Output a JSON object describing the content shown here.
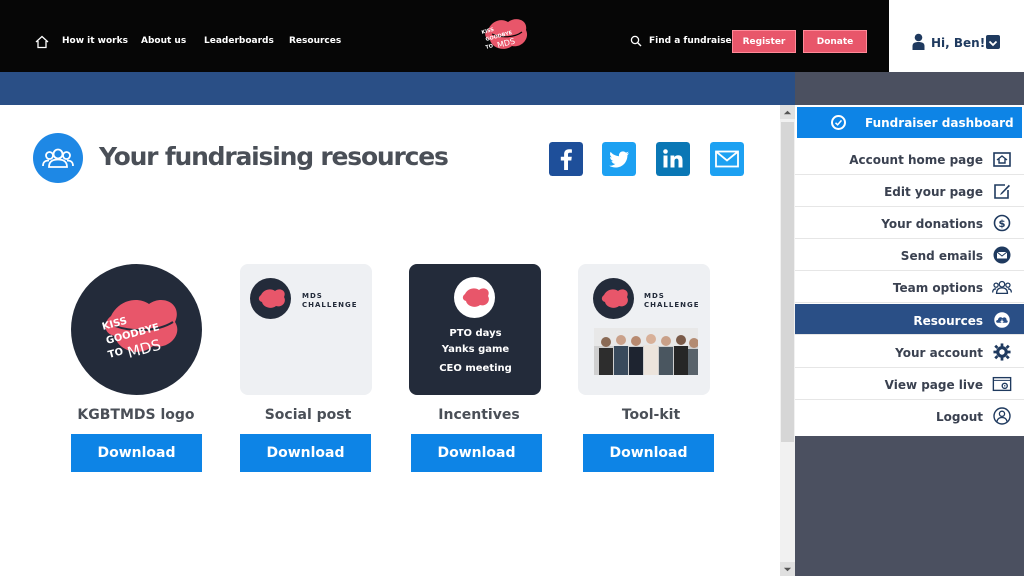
{
  "nav": {
    "links": [
      "How it works",
      "About us",
      "Leaderboards",
      "Resources"
    ],
    "find": "Find a fundraiser",
    "register": "Register",
    "donate": "Donate",
    "greeting": "Hi, Ben!",
    "logo_text": [
      "KISS",
      "GOODBYE",
      "TO",
      "MDS"
    ]
  },
  "page": {
    "title": "Your fundraising resources"
  },
  "resources": [
    {
      "label": "KGBTMDS logo",
      "download": "Download"
    },
    {
      "label": "Social post",
      "download": "Download",
      "card_text": [
        "MDS",
        "CHALLENGE"
      ]
    },
    {
      "label": "Incentives",
      "download": "Download",
      "card_lines": [
        "PTO days",
        "Yanks game",
        "CEO meeting"
      ]
    },
    {
      "label": "Tool-kit",
      "download": "Download",
      "card_text": [
        "MDS",
        "CHALLENGE"
      ]
    }
  ],
  "sidebar": {
    "header": "Fundraiser dashboard",
    "items": [
      {
        "label": "Account home page",
        "icon": "home-icon"
      },
      {
        "label": "Edit your page",
        "icon": "edit-icon"
      },
      {
        "label": "Your donations",
        "icon": "dollar-icon"
      },
      {
        "label": "Send emails",
        "icon": "email-icon"
      },
      {
        "label": "Team options",
        "icon": "team-icon"
      },
      {
        "label": "Resources",
        "icon": "cloud-download-icon"
      },
      {
        "label": "Your account",
        "icon": "gear-icon"
      },
      {
        "label": "View page live",
        "icon": "browser-gear-icon"
      },
      {
        "label": "Logout",
        "icon": "user-logout-icon"
      }
    ]
  },
  "colors": {
    "nav_bg": "#060606",
    "pink": "#e8566a",
    "blue_bar": "#2a4f86",
    "accent_blue": "#0d84e6",
    "dark_card": "#232b3a"
  }
}
